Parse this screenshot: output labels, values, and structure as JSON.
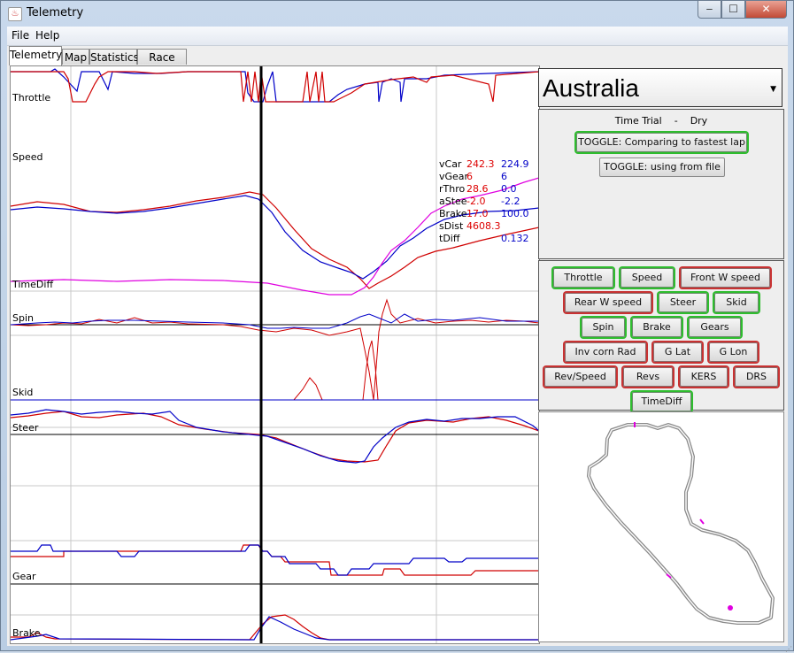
{
  "window": {
    "title": "Telemetry",
    "minimize": "‒",
    "maximize": "☐",
    "close": "✕",
    "icon": "java-cup-icon"
  },
  "menu": [
    "File",
    "Help"
  ],
  "tabs": [
    "Telemetry",
    "Map",
    "Statistics",
    "Race Info"
  ],
  "active_tab": "Telemetry",
  "channels": {
    "throttle": "Throttle",
    "speed": "Speed",
    "timediff": "TimeDiff",
    "spin": "Spin",
    "skid": "Skid",
    "steer": "Steer",
    "gear": "Gear",
    "brake": "Brake"
  },
  "readout": {
    "labels": [
      "vCar",
      "vGear",
      "rThro",
      "aStee",
      "Brake",
      "sDist",
      "tDiff"
    ],
    "current": [
      "242.3",
      "6",
      "28.6",
      "-2.0",
      "17.0",
      "4608.3",
      ""
    ],
    "compare": [
      "224.9",
      "6",
      "0.0",
      "-2.2",
      "100.0",
      "",
      "0.132"
    ]
  },
  "track": {
    "name": "Australia",
    "session_type": "Time Trial",
    "separator": "-",
    "conditions": "Dry"
  },
  "toggles": {
    "compare": "TOGGLE: Comparing to fastest lap",
    "source": "TOGGLE: using from file"
  },
  "channel_buttons": [
    {
      "label": "Throttle",
      "on": true
    },
    {
      "label": "Speed",
      "on": true
    },
    {
      "label": "Front W speed",
      "on": false
    },
    {
      "label": "Rear W speed",
      "on": false
    },
    {
      "label": "Steer",
      "on": true
    },
    {
      "label": "Skid",
      "on": true
    },
    {
      "label": "Spin",
      "on": true
    },
    {
      "label": "Brake",
      "on": true
    },
    {
      "label": "Gears",
      "on": true
    },
    {
      "label": "Inv corn Rad",
      "on": false
    },
    {
      "label": "G Lat",
      "on": false
    },
    {
      "label": "G Lon",
      "on": false
    },
    {
      "label": "Rev/Speed",
      "on": false
    },
    {
      "label": "Revs",
      "on": false
    },
    {
      "label": "KERS",
      "on": false
    },
    {
      "label": "DRS",
      "on": false
    },
    {
      "label": "TimeDiff",
      "on": true
    }
  ],
  "colors": {
    "current_lap": "#d00000",
    "compare_lap": "#0000c8",
    "timediff": "#e000e0",
    "cursor": "#000000",
    "toggle_on": "#2ebd2e",
    "toggle_off": "#c83232"
  }
}
